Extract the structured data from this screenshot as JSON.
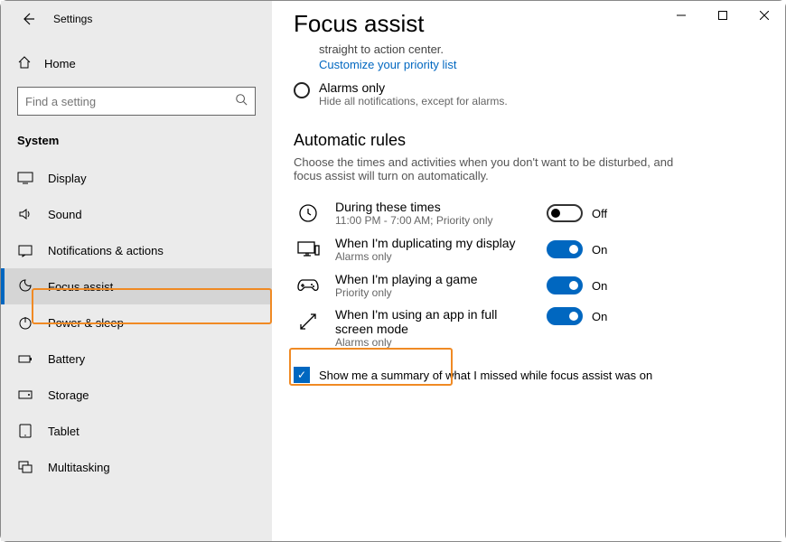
{
  "app_title": "Settings",
  "home_label": "Home",
  "search_placeholder": "Find a setting",
  "group_label": "System",
  "nav": [
    {
      "icon": "display",
      "label": "Display"
    },
    {
      "icon": "sound",
      "label": "Sound"
    },
    {
      "icon": "notify",
      "label": "Notifications & actions"
    },
    {
      "icon": "focus",
      "label": "Focus assist",
      "active": true
    },
    {
      "icon": "power",
      "label": "Power & sleep"
    },
    {
      "icon": "battery",
      "label": "Battery"
    },
    {
      "icon": "storage",
      "label": "Storage"
    },
    {
      "icon": "tablet",
      "label": "Tablet"
    },
    {
      "icon": "multitask",
      "label": "Multitasking"
    }
  ],
  "page": {
    "title": "Focus assist",
    "intro_text": "straight to action center.",
    "customize_link": "Customize your priority list",
    "alarms_title": "Alarms only",
    "alarms_sub": "Hide all notifications, except for alarms.",
    "rules_heading": "Automatic rules",
    "rules_sub": "Choose the times and activities when you don't want to be disturbed, and focus assist will turn on automatically.",
    "rules": [
      {
        "icon": "clock",
        "title": "During these times",
        "sub": "11:00 PM - 7:00 AM; Priority only",
        "on": false,
        "state": "Off"
      },
      {
        "icon": "dup",
        "title": "When I'm duplicating my display",
        "sub": "Alarms only",
        "on": true,
        "state": "On"
      },
      {
        "icon": "game",
        "title": "When I'm playing a game",
        "sub": "Priority only",
        "on": true,
        "state": "On",
        "highlight": true
      },
      {
        "icon": "full",
        "title": "When I'm using an app in full screen mode",
        "sub": "Alarms only",
        "on": true,
        "state": "On"
      }
    ],
    "summary_checkbox": "Show me a summary of what I missed while focus assist was on"
  }
}
